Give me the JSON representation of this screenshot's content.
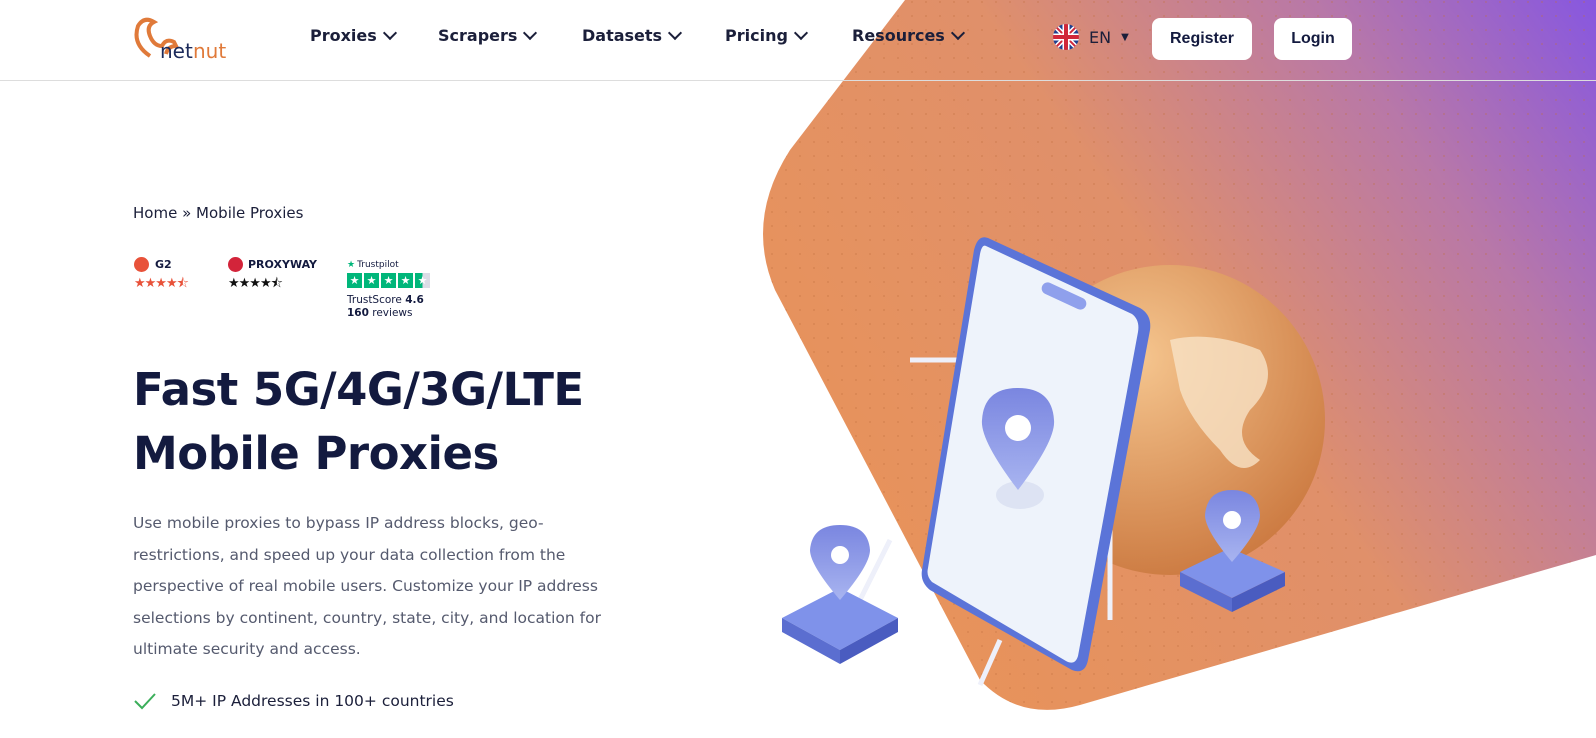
{
  "header": {
    "brand": "netnut",
    "nav": [
      {
        "label": "Proxies"
      },
      {
        "label": "Scrapers"
      },
      {
        "label": "Datasets"
      },
      {
        "label": "Pricing"
      },
      {
        "label": "Resources"
      }
    ],
    "language": "EN",
    "register_label": "Register",
    "login_label": "Login"
  },
  "breadcrumb": {
    "home": "Home",
    "separator": "»",
    "current": "Mobile Proxies"
  },
  "ratings": {
    "g2": {
      "label": "G2",
      "stars": 4.5,
      "color": "#e8523a"
    },
    "proxyway": {
      "label": "PROXYWAY",
      "stars": 4.5
    },
    "trustpilot": {
      "label": "Trustpilot",
      "stars": 4.5,
      "score_label": "TrustScore",
      "score": "4.6",
      "reviews_count": "160",
      "reviews_label": "reviews",
      "color": "#00b67a"
    }
  },
  "hero": {
    "title_line1": "Fast 5G/4G/3G/LTE",
    "title_line2": "Mobile Proxies",
    "description": "Use mobile proxies to bypass IP address blocks, geo-restrictions, and speed up your data collection from the perspective of real mobile users. Customize your IP address selections by continent, country, state, city, and location for ultimate security and access.",
    "features": [
      {
        "text": "5M+ IP Addresses in 100+ countries"
      }
    ]
  },
  "colors": {
    "accent_orange": "#e8935a",
    "accent_purple": "#8a5ae0",
    "text_dark": "#131a3f"
  }
}
